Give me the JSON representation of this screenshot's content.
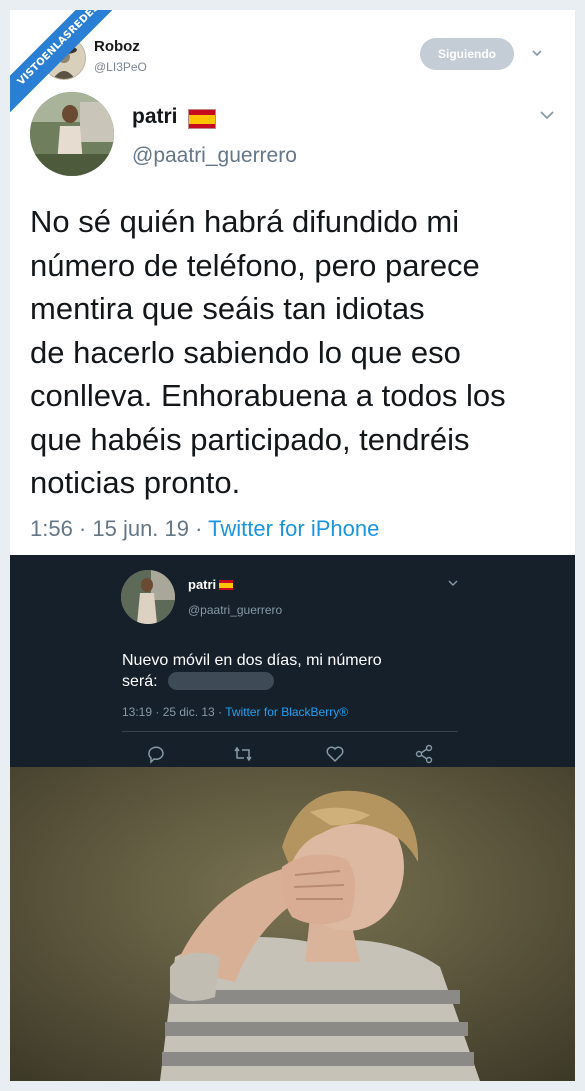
{
  "watermark": {
    "text": "VISTOENLASREDES"
  },
  "follower_tweet": {
    "user": {
      "name": "Roboz",
      "handle": "@LI3PeO"
    },
    "follow_button": "Siguiendo"
  },
  "main_tweet": {
    "user": {
      "name": "patri",
      "handle": "@paatri_guerrero"
    },
    "text_lines": [
      "No sé quién habrá difundido mi",
      "número de teléfono, pero parece",
      "mentira que seáis tan idiotas",
      "de hacerlo sabiendo lo que eso",
      "conlleva. Enhorabuena a todos los",
      "que habéis participado, tendréis",
      "noticias pronto."
    ],
    "time": "1:56 · 15 jun. 19 · ",
    "source": "Twitter for iPhone"
  },
  "old_tweet": {
    "user": {
      "name": "patri",
      "handle": "@paatri_guerrero"
    },
    "text_line1": "Nuevo móvil en dos días, mi número",
    "text_line2": "será:",
    "time": "13:19 · 25 dic. 13 · ",
    "source": "Twitter for BlackBerry®",
    "actions": [
      "reply-icon",
      "retweet-icon",
      "like-icon",
      "share-icon"
    ]
  },
  "colors": {
    "accent": "#1b95e0",
    "dark_bg": "#15202b",
    "watermark": "#2a7fd4"
  }
}
